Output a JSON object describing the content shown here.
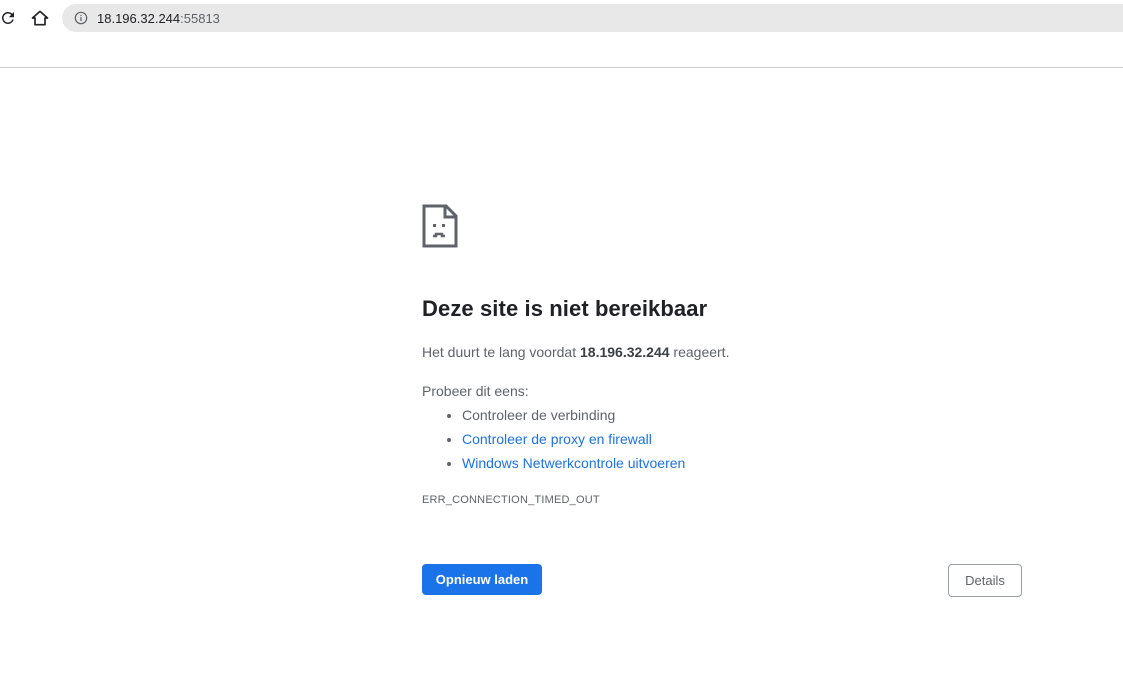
{
  "toolbar": {
    "reload_icon": "reload-icon",
    "home_icon": "home-icon",
    "info_icon": "info-icon",
    "url_host": "18.196.32.244",
    "url_port": ":55813"
  },
  "error_page": {
    "icon": "sad-page-icon",
    "title": "Deze site is niet bereikbaar",
    "desc_prefix": "Het duurt te lang voordat ",
    "desc_host": "18.196.32.244",
    "desc_suffix": " reageert.",
    "suggestions_intro": "Probeer dit eens:",
    "suggestions": [
      "Controleer de verbinding",
      "Controleer de proxy en firewall",
      "Windows Netwerkcontrole uitvoeren"
    ],
    "error_code": "ERR_CONNECTION_TIMED_OUT",
    "reload_label": "Opnieuw laden",
    "details_label": "Details"
  },
  "colors": {
    "accent": "#1a73e8",
    "text_primary": "#202124",
    "text_secondary": "#5f6368"
  }
}
